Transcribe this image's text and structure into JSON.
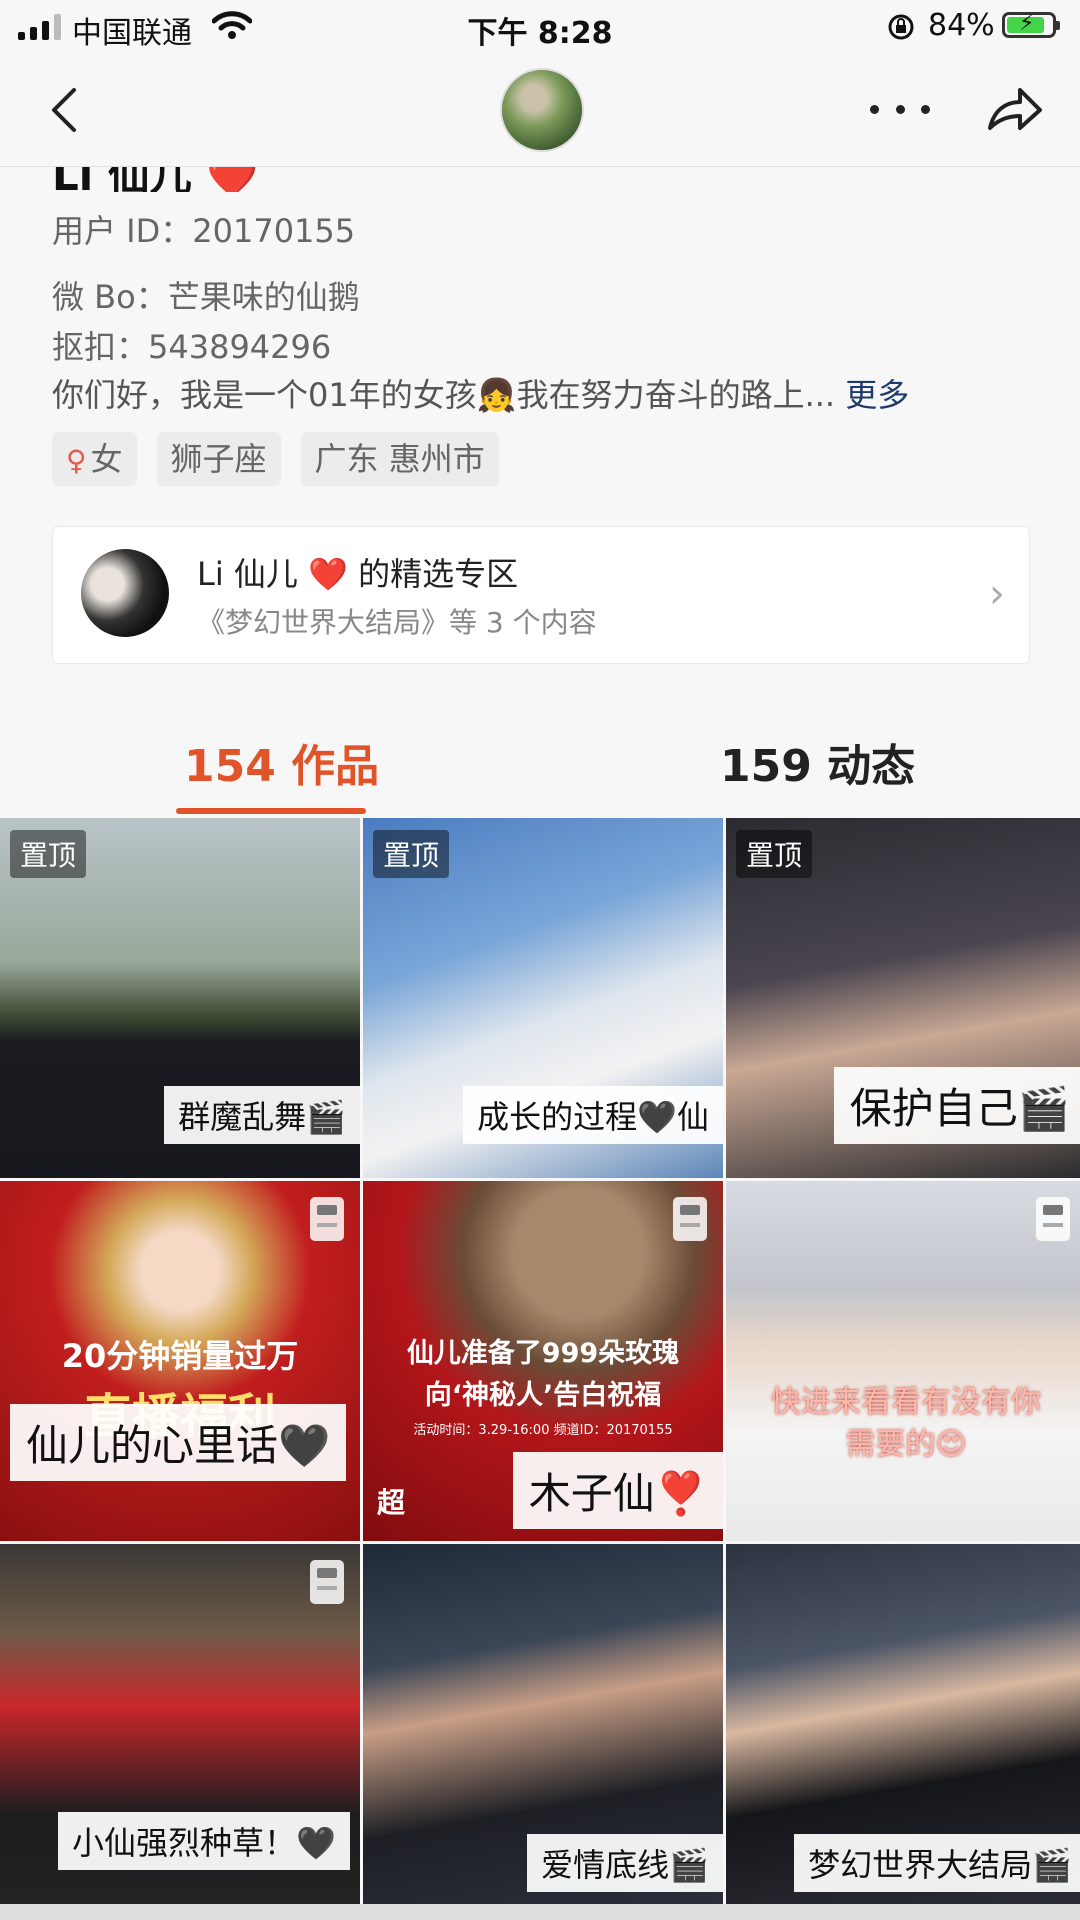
{
  "status_bar": {
    "carrier": "中国联通",
    "time": "下午 8:28",
    "battery_percent": "84%",
    "battery_level": 0.84,
    "icons": [
      "signal-icon",
      "wifi-icon",
      "rotation-lock-icon",
      "battery-charging-icon"
    ]
  },
  "nav": {
    "icons": [
      "back-icon",
      "avatar",
      "more-icon",
      "share-icon"
    ]
  },
  "profile": {
    "name": "Li 仙儿",
    "name_emoji": "❤️",
    "user_id": "用户 ID：20170155",
    "weibo": "微 Bo：芒果味的仙鹅",
    "qq": "抠扣：543894296",
    "bio": "你们好，我是一个01年的女孩👧我在努力奋斗的路上...",
    "bio_more": "更多",
    "tags": {
      "gender_symbol": "♀",
      "gender": "女",
      "zodiac": "狮子座",
      "location": "广东 惠州市"
    }
  },
  "collection": {
    "title_name": "Li 仙儿",
    "title_heart": "❤️",
    "title_suffix": "的精选专区",
    "subtitle": "《梦幻世界大结局》等 3 个内容",
    "chevron": "›"
  },
  "tabs": {
    "works": "154 作品",
    "feed": "159 动态"
  },
  "grid": {
    "pinned_label": "置顶",
    "items": [
      {
        "caption": "群魔乱舞🎬"
      },
      {
        "caption": "成长的过程🖤仙"
      },
      {
        "caption": "保护自己🎬"
      },
      {
        "caption": "仙儿的心里话🖤",
        "promo_line1": "20分钟销量过万",
        "promo_line2": "直播福利"
      },
      {
        "caption": "木子仙❣️",
        "promo_line1": "仙儿准备了999朵玫瑰",
        "promo_line2": "向‘神秘人’告白祝福",
        "promo_line3": "活动时间：3.29-16:00 频道ID：20170155",
        "promo_line4": "超"
      },
      {
        "overlay_line1": "快进来看看有没有你",
        "overlay_line2": "需要的😍"
      },
      {
        "caption": "小仙强烈种草！🖤"
      },
      {
        "caption": "爱情底线🎬"
      },
      {
        "caption": "梦幻世界大结局🎬"
      }
    ]
  }
}
